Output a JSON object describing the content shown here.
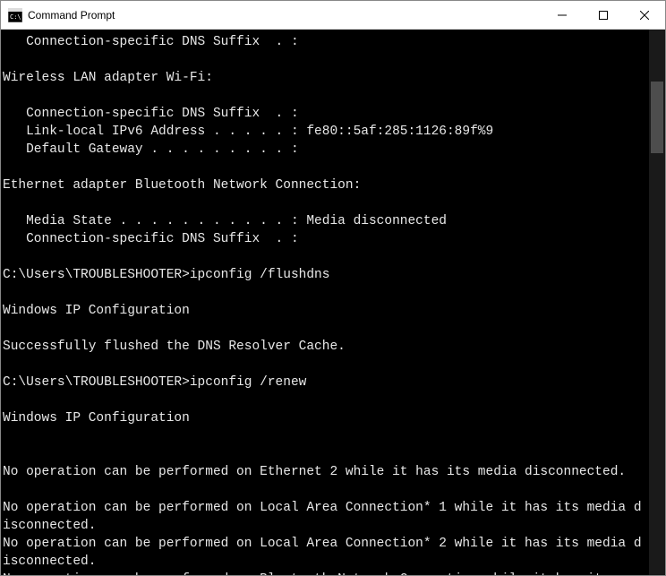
{
  "window": {
    "title": "Command Prompt"
  },
  "terminal": {
    "lines": [
      "   Connection-specific DNS Suffix  . :",
      "",
      "Wireless LAN adapter Wi-Fi:",
      "",
      "   Connection-specific DNS Suffix  . :",
      "   Link-local IPv6 Address . . . . . : fe80::5af:285:1126:89f%9",
      "   Default Gateway . . . . . . . . . :",
      "",
      "Ethernet adapter Bluetooth Network Connection:",
      "",
      "   Media State . . . . . . . . . . . : Media disconnected",
      "   Connection-specific DNS Suffix  . :",
      "",
      "C:\\Users\\TROUBLESHOOTER>ipconfig /flushdns",
      "",
      "Windows IP Configuration",
      "",
      "Successfully flushed the DNS Resolver Cache.",
      "",
      "C:\\Users\\TROUBLESHOOTER>ipconfig /renew",
      "",
      "Windows IP Configuration",
      "",
      "",
      "No operation can be performed on Ethernet 2 while it has its media disconnected.",
      "",
      "No operation can be performed on Local Area Connection* 1 while it has its media disconnected.",
      "No operation can be performed on Local Area Connection* 2 while it has its media disconnected.",
      "No operation can be performed on Bluetooth Network Connection while it has its m"
    ]
  }
}
